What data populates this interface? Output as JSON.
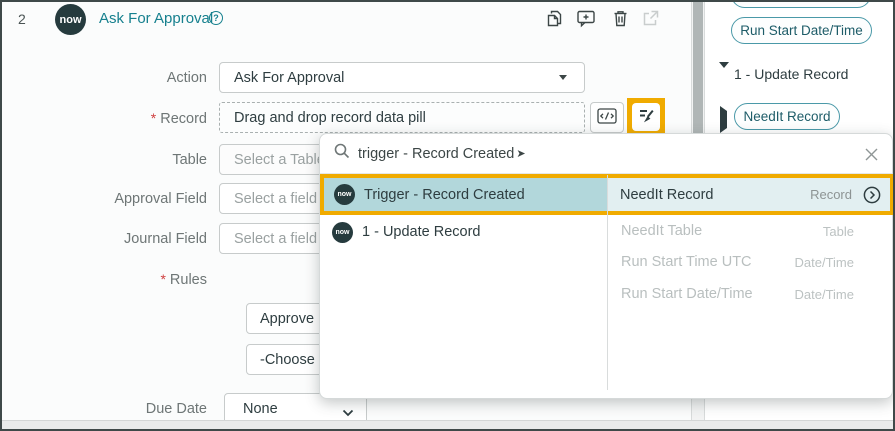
{
  "window": {
    "step_number": "2",
    "title": "Ask For Approval"
  },
  "logo": {
    "text": "now"
  },
  "icons": [
    "help-icon",
    "copy-icon",
    "add-comment-icon",
    "trash-icon",
    "open-in-new-icon",
    "script-toggle-icon",
    "data-pill-picker-icon",
    "search-icon",
    "close-icon",
    "drill-in-icon",
    "chevron-down-icon"
  ],
  "form": {
    "required_marker": "*",
    "action_label": "Action",
    "action_value": "Ask For Approval",
    "record_label": "Record",
    "record_placeholder": "Drag and drop record data pill",
    "table_label": "Table",
    "table_placeholder": "Select a Table",
    "approval_field_label": "Approval Field",
    "approval_field_placeholder": "Select a field",
    "journal_field_label": "Journal Field",
    "journal_field_placeholder": "Select a field",
    "rules_label": "Rules",
    "approve_button_label": "Approve",
    "choose_value": "-Choose a",
    "due_date_label": "Due Date",
    "due_date_value": "None"
  },
  "data_panel": {
    "pill_run_start": "Run Start Date/Time",
    "section_label": "1 - Update Record",
    "pill_needit_record": "NeedIt Record"
  },
  "popup": {
    "search_value": "trigger - Record Created",
    "search_caret": "➤",
    "left_items": [
      {
        "label": "Trigger - Record Created"
      },
      {
        "label": "1 - Update Record"
      }
    ],
    "right_items": [
      {
        "name": "NeedIt Record",
        "type": "Record"
      },
      {
        "name": "NeedIt Table",
        "type": "Table"
      },
      {
        "name": "Run Start Time UTC",
        "type": "Date/Time"
      },
      {
        "name": "Run Start Date/Time",
        "type": "Date/Time"
      }
    ]
  },
  "colors": {
    "accent_teal": "#16808e",
    "highlight_orange": "#f0ab00",
    "selected_row_teal": "#b2d7db",
    "selected_cell_teal": "#e2eff1",
    "required_red": "#cf3f3f"
  }
}
